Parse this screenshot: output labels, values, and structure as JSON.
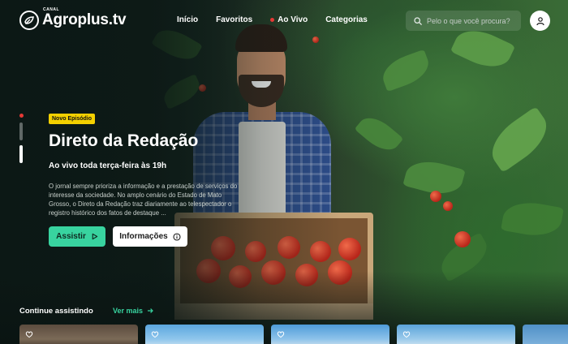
{
  "brand": {
    "canal": "CANAL",
    "name": "Agroplus.tv"
  },
  "nav": {
    "items": [
      "Início",
      "Favoritos",
      "Ao Vivo",
      "Categorias"
    ],
    "live_indicator_color": "#e53935"
  },
  "search": {
    "placeholder": "Pelo o que você procura?"
  },
  "hero": {
    "badge": "Novo Episódio",
    "title": "Direto da Redação",
    "subtitle": "Ao vivo toda terça-feira às 19h",
    "description": "O jornal sempre prioriza a informação e a prestação de serviços do interesse da sociedade. No amplo cenário do Estado de Mato Grosso, o Direto da Redação traz diariamente ao telespectador o registro histórico dos fatos de destaque ...",
    "play_label": "Assistir",
    "info_label": "Informações"
  },
  "continue_watching": {
    "title": "Continue assistindo",
    "see_more": "Ver mais"
  },
  "colors": {
    "accent": "#38d39f",
    "badge": "#f4d000",
    "live": "#e53935",
    "background": "#0f1d1a"
  },
  "icons": [
    "logo-mark-icon",
    "search-icon",
    "user-icon",
    "play-icon",
    "info-icon",
    "arrow-right-icon",
    "heart-icon"
  ]
}
